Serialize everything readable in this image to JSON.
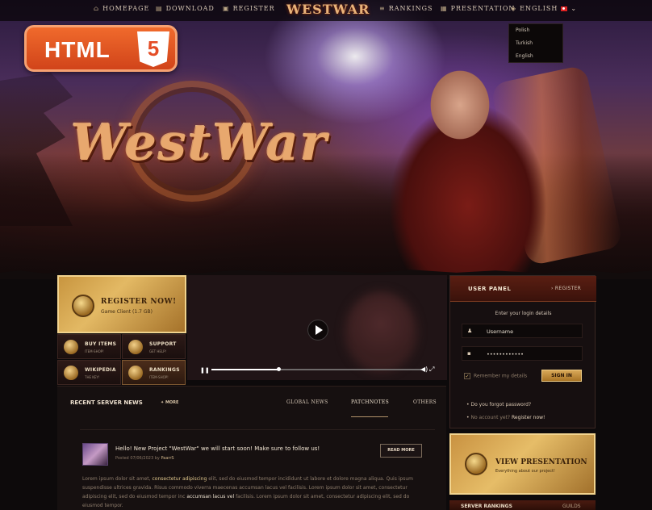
{
  "nav": {
    "items": [
      {
        "label": "Homepage",
        "icon": "home-icon"
      },
      {
        "label": "Download",
        "icon": "download-icon"
      },
      {
        "label": "Register",
        "icon": "register-icon"
      },
      {
        "label": "Rankings",
        "icon": "rankings-icon"
      },
      {
        "label": "Presentation",
        "icon": "presentation-icon"
      }
    ],
    "logo": "WESTWAR",
    "language": "English",
    "language_options": [
      "Polish",
      "Turkish",
      "English"
    ]
  },
  "badge": {
    "label": "HTML",
    "number": "5"
  },
  "hero": {
    "logo": "WestWar"
  },
  "register_box": {
    "title": "REGISTER NOW!",
    "subtitle": "Game Client (1.7 GB)"
  },
  "quick_links": [
    {
      "label": "BUY ITEMS",
      "sub": "ITEM-SHOP!"
    },
    {
      "label": "SUPPORT",
      "sub": "GET HELP!"
    },
    {
      "label": "WIKIPEDIA",
      "sub": "THE KEY!"
    },
    {
      "label": "RANKINGS",
      "sub": "ITEM-SHOP!"
    }
  ],
  "video": {
    "progress": 0.32
  },
  "user_panel": {
    "title": "USER PANEL",
    "register_link": "REGISTER",
    "lead": "Enter your login details",
    "username_value": "Username",
    "password_value": "••••••••••••",
    "remember_label": "Remember my details",
    "signin_label": "SIGN IN",
    "forgot_label": "Do you forgot password?",
    "no_account_prefix": "No account yet?",
    "no_account_link": "Register now!"
  },
  "presentation_box": {
    "title": "VIEW PRESENTATION",
    "subtitle": "Everything about our project!"
  },
  "rankings_strip": {
    "title": "SERVER RANKINGS",
    "tab": "GUILDS"
  },
  "news": {
    "title": "RECENT SERVER NEWS",
    "more": "MORE",
    "tabs": [
      "GLOBAL NEWS",
      "PATCHNOTES",
      "OTHERS"
    ],
    "active_tab": "PATCHNOTES",
    "post": {
      "title": "Hello! New Project \"WestWar\" we will start soon! Make sure to follow us!",
      "meta_prefix": "Posted",
      "date": "07/06/2023",
      "by": "by",
      "author": "PaarrS",
      "read_more": "READ MORE",
      "body_1": "Lorem ipsum dolor sit amet,",
      "body_hl1": "consectetur adipiscing",
      "body_2": "elit, sed do eiusmod tempor incididunt ut labore et dolore magna aliqua. Quis ipsum suspendisse ultrices gravida. Risus commodo viverra maecenas accumsan lacus vel facilisis. Lorem ipsum dolor sit amet, consectetur adipiscing elit, sed do eiusmod tempor inc",
      "body_hl2": "accumsan lacus vel",
      "body_3": "facilisis. Lorem ipsum dolor sit amet, consectetur adipiscing elit, sed do eiusmod tempor."
    }
  }
}
